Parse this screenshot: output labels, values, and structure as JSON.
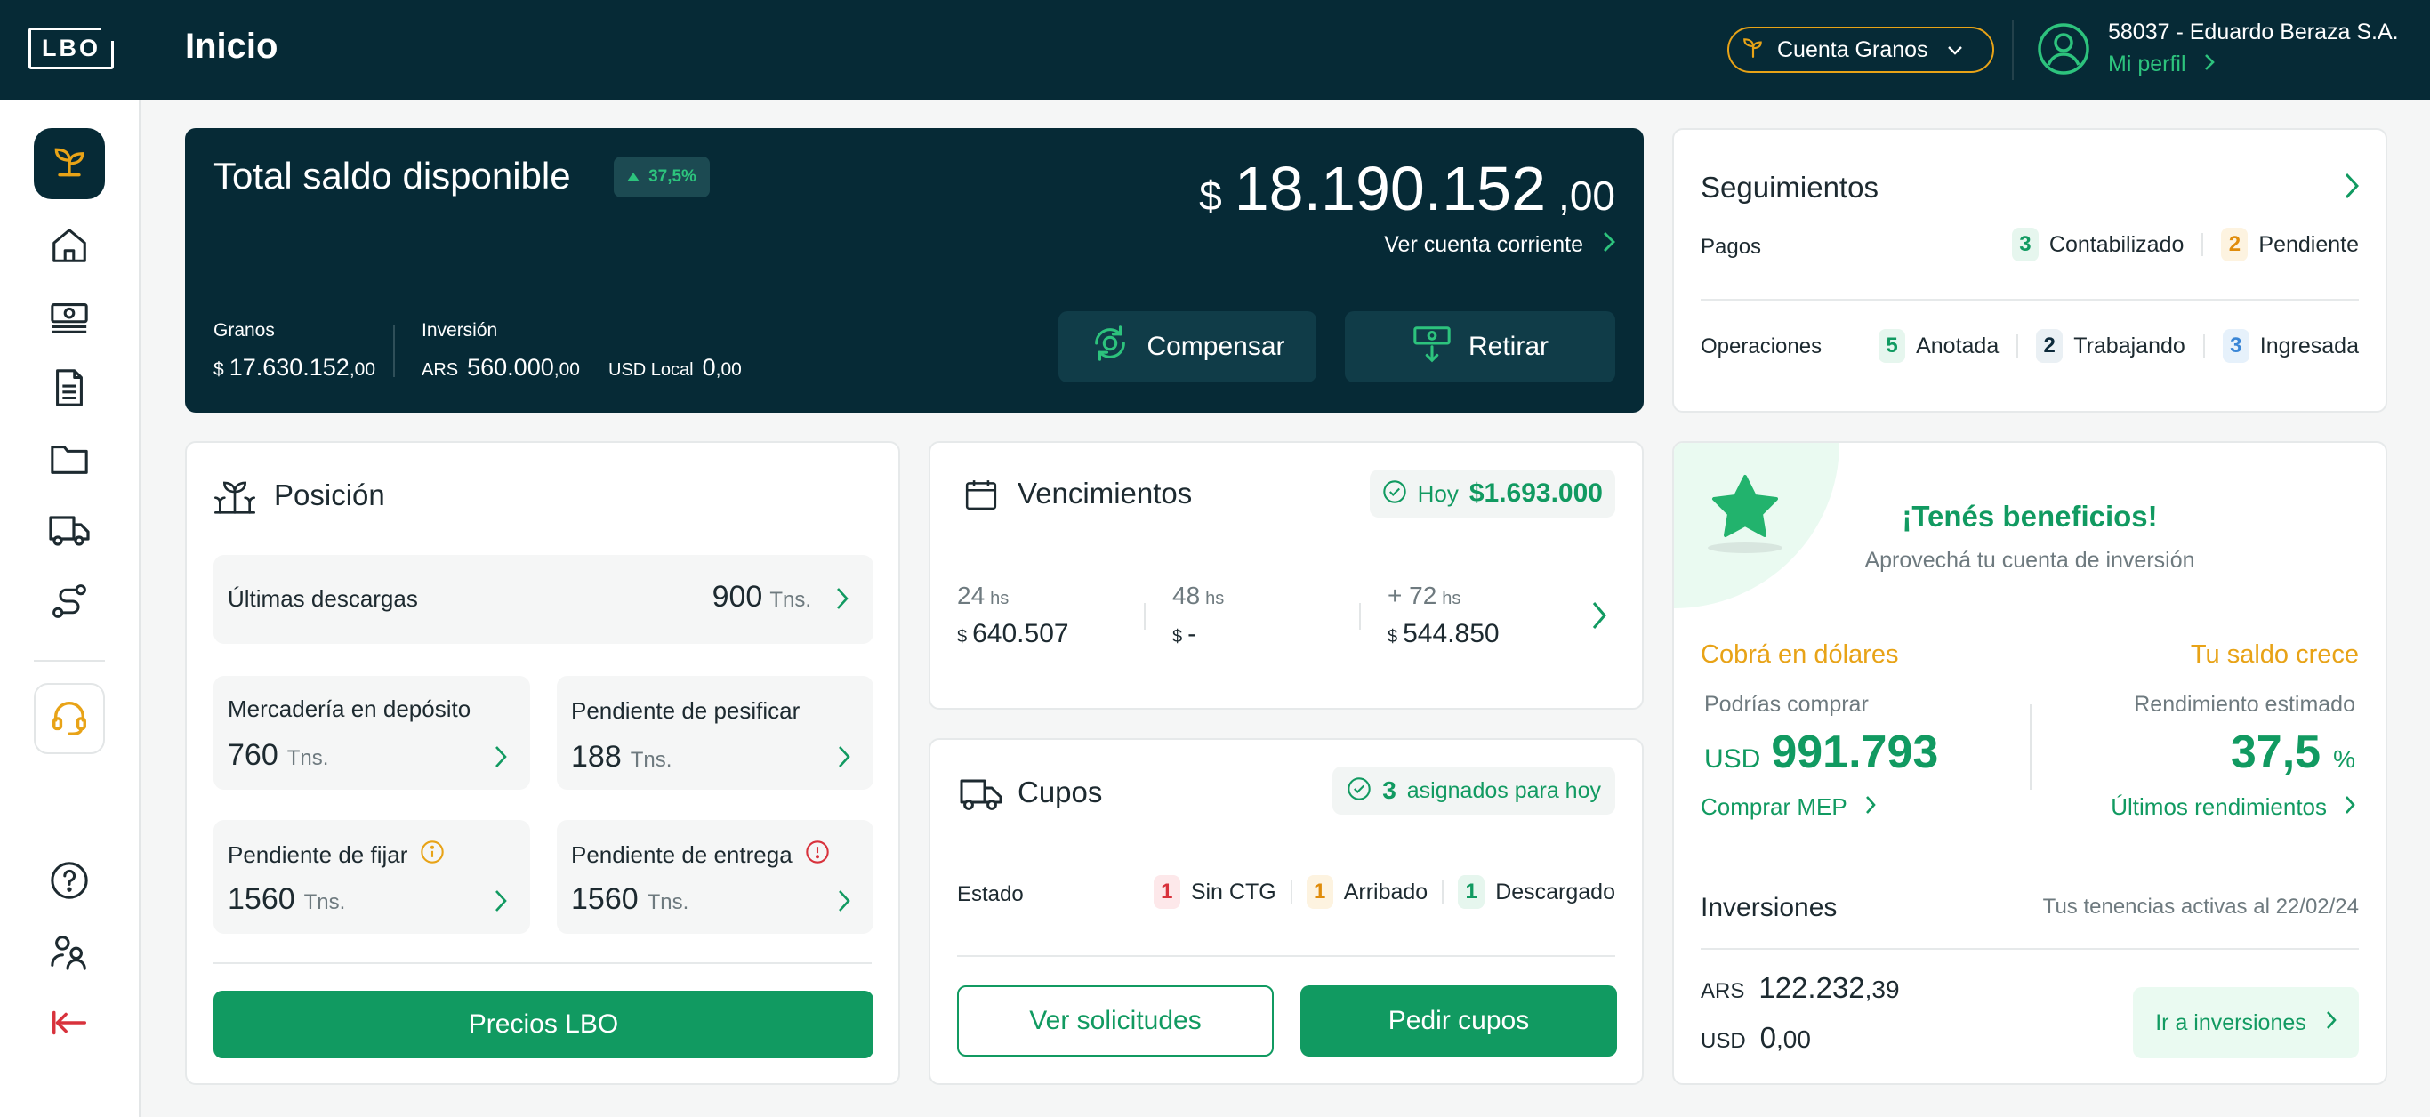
{
  "header": {
    "logo": "LBO",
    "title": "Inicio",
    "account_select": "Cuenta Granos",
    "user_name": "58037 - Eduardo Beraza S.A.",
    "profile_link": "Mi perfil"
  },
  "sidebar": {
    "items": [
      "sprout-icon",
      "home-icon",
      "money-icon",
      "document-icon",
      "folder-icon",
      "truck-icon",
      "route-icon",
      "headset-icon",
      "help-icon",
      "users-icon",
      "logout-icon"
    ]
  },
  "balance": {
    "title": "Total saldo disponible",
    "badge": "37,5%",
    "currency_symbol": "$",
    "amount": "18.190.152",
    "decimals": ",00",
    "link": "Ver cuenta corriente",
    "granos_label": "Granos",
    "granos_symbol": "$",
    "granos_amount": "17.630.152",
    "granos_decimals": ",00",
    "inversion_label": "Inversión",
    "ars_label": "ARS",
    "ars_amount": "560.000",
    "ars_decimals": ",00",
    "usd_label": "USD Local",
    "usd_amount": "0",
    "usd_decimals": ",00",
    "compensar": "Compensar",
    "retirar": "Retirar"
  },
  "seguimientos": {
    "title": "Seguimientos",
    "pagos_label": "Pagos",
    "pagos": [
      {
        "count": "3",
        "label": "Contabilizado",
        "color": "green"
      },
      {
        "count": "2",
        "label": "Pendiente",
        "color": "orange"
      }
    ],
    "operaciones_label": "Operaciones",
    "operaciones": [
      {
        "count": "5",
        "label": "Anotada",
        "color": "green"
      },
      {
        "count": "2",
        "label": "Trabajando",
        "color": "navy"
      },
      {
        "count": "3",
        "label": "Ingresada",
        "color": "blue"
      }
    ]
  },
  "posicion": {
    "title": "Posición",
    "descargas_label": "Últimas descargas",
    "descargas_value": "900",
    "unit": "Tns.",
    "tiles": [
      {
        "label": "Mercadería en depósito",
        "value": "760"
      },
      {
        "label": "Pendiente de pesificar",
        "value": "188"
      },
      {
        "label": "Pendiente de fijar",
        "value": "1560"
      },
      {
        "label": "Pendiente de entrega",
        "value": "1560"
      }
    ],
    "button": "Precios LBO"
  },
  "vencimientos": {
    "title": "Vencimientos",
    "hoy_label": "Hoy",
    "hoy_amount": "$1.693.000",
    "cols": [
      {
        "label": "24",
        "unit": "hs",
        "symbol": "$",
        "amount": "640.507"
      },
      {
        "label": "48",
        "unit": "hs",
        "symbol": "$",
        "amount": "-"
      },
      {
        "label": "+ 72",
        "unit": "hs",
        "symbol": "$",
        "amount": "544.850"
      }
    ]
  },
  "cupos": {
    "title": "Cupos",
    "assigned_count": "3",
    "assigned_label": "asignados para hoy",
    "estado_label": "Estado",
    "estados": [
      {
        "count": "1",
        "label": "Sin CTG",
        "color": "red"
      },
      {
        "count": "1",
        "label": "Arribado",
        "color": "orange"
      },
      {
        "count": "1",
        "label": "Descargado",
        "color": "green"
      }
    ],
    "ver_solicitudes": "Ver solicitudes",
    "pedir_cupos": "Pedir cupos"
  },
  "beneficios": {
    "title": "¡Tenés beneficios!",
    "subtitle": "Aprovechá tu cuenta de inversión",
    "cobra_title": "Cobrá en dólares",
    "podrias": "Podrías comprar",
    "usd_label": "USD",
    "usd_amount": "991.793",
    "comprar_link": "Comprar MEP",
    "saldo_title": "Tu saldo crece",
    "rendimiento_label": "Rendimiento estimado",
    "rendimiento_value": "37,5",
    "rendimiento_unit": "%",
    "rendimientos_link": "Últimos rendimientos",
    "inversiones_title": "Inversiones",
    "tenencias": "Tus tenencias activas al 22/02/24",
    "ars_label": "ARS",
    "ars_amount": "122.232",
    "ars_decimals": ",39",
    "usd_label2": "USD",
    "usd_amount2": "0",
    "usd_decimals2": ",00",
    "ir_link": "Ir a inversiones"
  },
  "colors": {
    "navy": "#062a36",
    "green": "#119a61",
    "accent_green": "#2dc37d",
    "orange": "#e8a317"
  }
}
